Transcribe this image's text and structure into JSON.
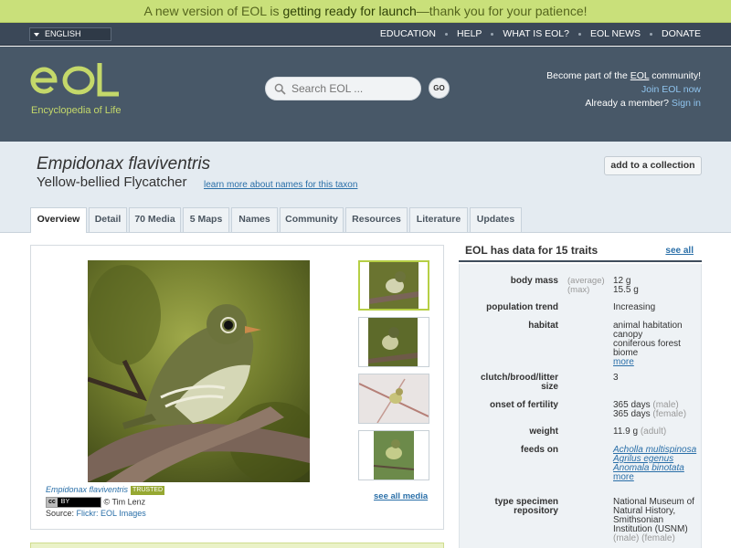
{
  "banner": {
    "pre": "A new version of EOL is ",
    "strong": "getting ready for launch",
    "dash": "—",
    "post": "thank you for your patience!"
  },
  "language": {
    "selected": "ENGLISH"
  },
  "nav": [
    "EDUCATION",
    "HELP",
    "WHAT IS EOL?",
    "EOL NEWS",
    "DONATE"
  ],
  "header": {
    "tagline": "Encyclopedia of Life",
    "search_placeholder": "Search EOL ...",
    "go_label": "GO",
    "community_pre": "Become part of the ",
    "community_eol": "EOL",
    "community_post": " community!",
    "join_label": "Join EOL now",
    "already_member": "Already a member? ",
    "signin_label": "Sign in"
  },
  "taxon": {
    "scientific_name": "Empidonax flaviventris",
    "common_name": "Yellow-bellied Flycatcher",
    "learn_more": "learn more about names for this taxon",
    "add_collection": "add to a collection"
  },
  "tabs": [
    "Overview",
    "Detail",
    "70 Media",
    "5 Maps",
    "Names",
    "Community",
    "Resources",
    "Literature",
    "Updates"
  ],
  "media": {
    "caption_name": "Empidonax flaviventris",
    "trusted": "TRUSTED",
    "license_icon": "cc-by-icon",
    "license_cc": "cc",
    "license_by": "BY",
    "author": "© Tim Lenz",
    "source_label": "Source: ",
    "source_link": "Flickr: EOL Images",
    "see_all": "see all media"
  },
  "traits": {
    "title": "EOL has data for 15 traits",
    "see_all": "see all",
    "rows": [
      {
        "label": "body mass",
        "quals": [
          "(average)",
          "(max)"
        ],
        "values": [
          "12 g",
          "15.5 g"
        ]
      },
      {
        "label": "population trend",
        "values": [
          "Increasing"
        ]
      },
      {
        "label": "habitat",
        "values": [
          "animal habitation",
          "canopy",
          "coniferous forest",
          "biome"
        ],
        "more": "more"
      },
      {
        "label": "clutch/brood/litter size",
        "values": [
          "3"
        ]
      },
      {
        "label": "onset of fertility",
        "values": [
          "365 days",
          "365 days"
        ],
        "notes": [
          "(male)",
          "(female)"
        ]
      },
      {
        "label": "weight",
        "values": [
          "11.9 g"
        ],
        "notes": [
          "(adult)"
        ]
      },
      {
        "label": "feeds on",
        "links": [
          "Acholla multispinosa",
          "Agrilus egenus",
          "Anomala binotata"
        ],
        "more": "more"
      },
      {
        "label": "type specimen repository",
        "values": [
          "National Museum of",
          "Natural History,",
          "Smithsonian",
          "Institution (USNM)"
        ],
        "notes": [
          "(male)",
          "(female)"
        ]
      }
    ]
  },
  "colors": {
    "accent_green": "#c4d86a",
    "header_blue": "#485868",
    "link_blue": "#2a6fa8"
  }
}
